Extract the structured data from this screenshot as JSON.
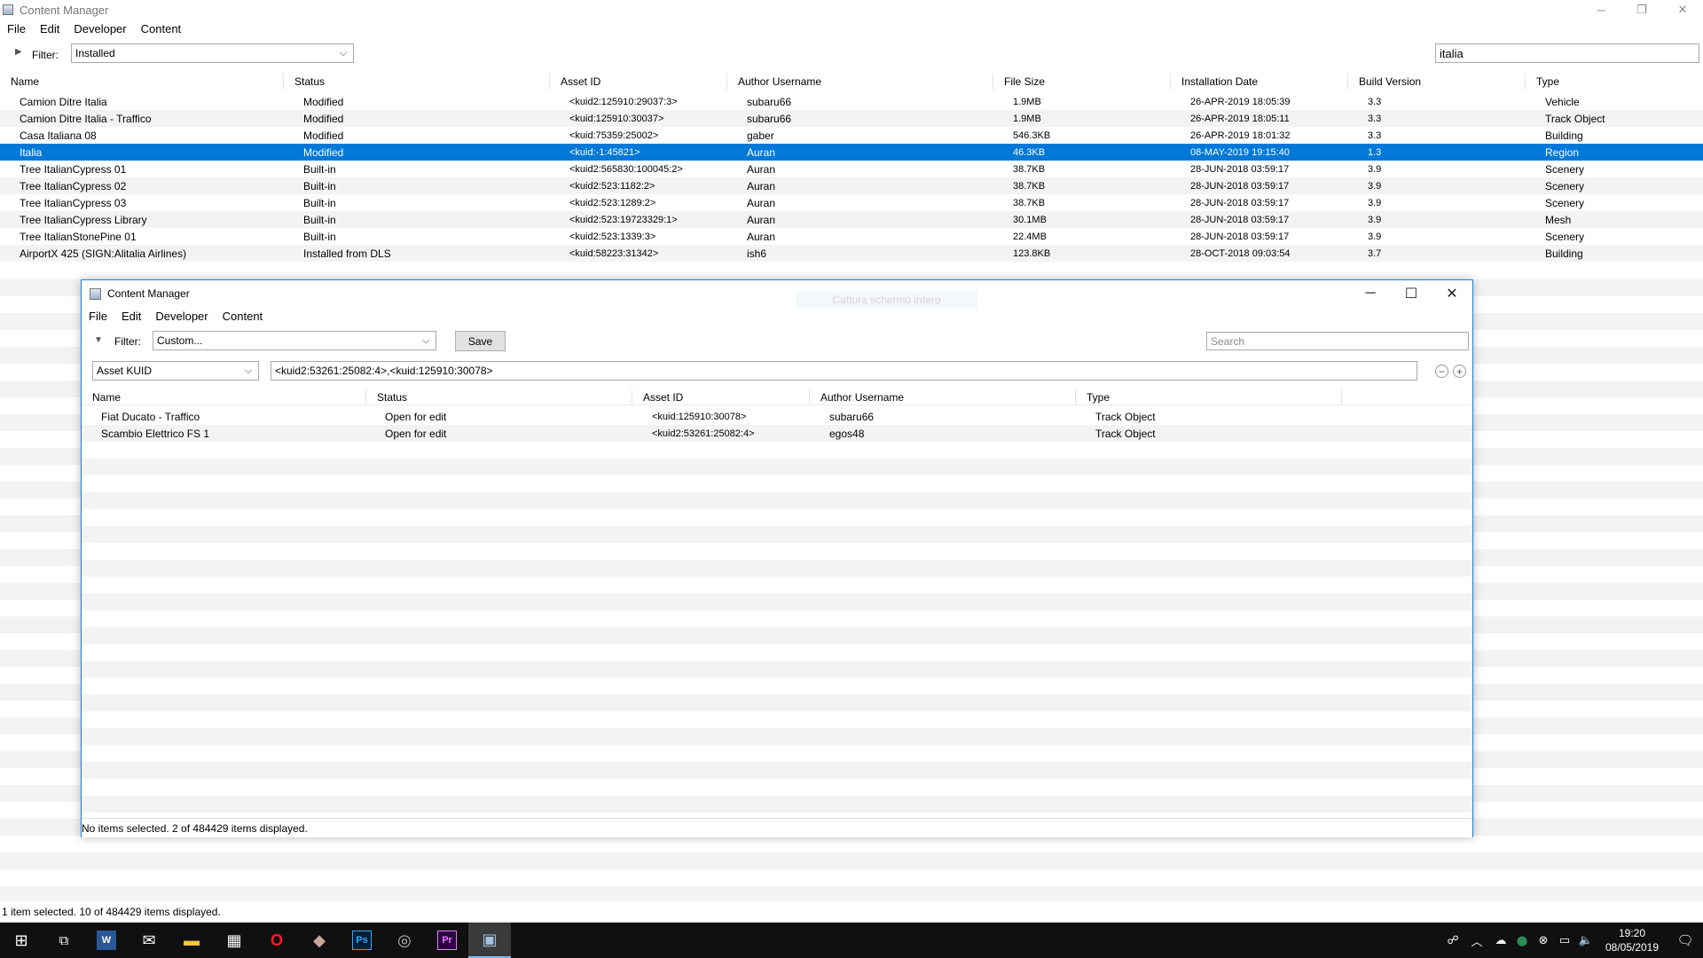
{
  "main": {
    "title": "Content Manager",
    "window_controls": {
      "minimize": "─",
      "restore": "❐",
      "close": "✕"
    },
    "menu": [
      "File",
      "Edit",
      "Developer",
      "Content"
    ],
    "filter": {
      "expander": "▶",
      "label": "Filter:",
      "value": "Installed",
      "chevron": "⌵"
    },
    "search_value": "italia",
    "columns": [
      "Name",
      "Status",
      "Asset ID",
      "Author Username",
      "File Size",
      "Installation Date",
      "Build Version",
      "Type"
    ],
    "rows": [
      {
        "name": "Camion Ditre Italia",
        "status": "Modified",
        "asset_id": "<kuid2:125910:29037:3>",
        "author": "subaru66",
        "size": "1.9MB",
        "date": "26-APR-2019 18:05:39",
        "build": "3.3",
        "type": "Vehicle"
      },
      {
        "name": "Camion Ditre Italia  - Traffico",
        "status": "Modified",
        "asset_id": "<kuid:125910:30037>",
        "author": "subaru66",
        "size": "1.9MB",
        "date": "26-APR-2019 18:05:11",
        "build": "3.3",
        "type": "Track Object"
      },
      {
        "name": "Casa Italiana 08",
        "status": "Modified",
        "asset_id": "<kuid:75359:25002>",
        "author": "gaber",
        "size": "546.3KB",
        "date": "26-APR-2019 18:01:32",
        "build": "3.3",
        "type": "Building"
      },
      {
        "name": "Italia",
        "status": "Modified",
        "asset_id": "<kuid:-1:45821>",
        "author": "Auran",
        "size": "46.3KB",
        "date": "08-MAY-2019 19:15:40",
        "build": "1.3",
        "type": "Region"
      },
      {
        "name": "Tree ItalianCypress 01",
        "status": "Built-in",
        "asset_id": "<kuid2:565830:100045:2>",
        "author": "Auran",
        "size": "38.7KB",
        "date": "28-JUN-2018 03:59:17",
        "build": "3.9",
        "type": "Scenery"
      },
      {
        "name": "Tree ItalianCypress 02",
        "status": "Built-in",
        "asset_id": "<kuid2:523:1182:2>",
        "author": "Auran",
        "size": "38.7KB",
        "date": "28-JUN-2018 03:59:17",
        "build": "3.9",
        "type": "Scenery"
      },
      {
        "name": "Tree ItalianCypress 03",
        "status": "Built-in",
        "asset_id": "<kuid2:523:1289:2>",
        "author": "Auran",
        "size": "38.7KB",
        "date": "28-JUN-2018 03:59:17",
        "build": "3.9",
        "type": "Scenery"
      },
      {
        "name": "Tree ItalianCypress Library",
        "status": "Built-in",
        "asset_id": "<kuid2:523:19723329:1>",
        "author": "Auran",
        "size": "30.1MB",
        "date": "28-JUN-2018 03:59:17",
        "build": "3.9",
        "type": "Mesh"
      },
      {
        "name": "Tree ItalianStonePine 01",
        "status": "Built-in",
        "asset_id": "<kuid2:523:1339:3>",
        "author": "Auran",
        "size": "22.4MB",
        "date": "28-JUN-2018 03:59:17",
        "build": "3.9",
        "type": "Scenery"
      },
      {
        "name": "AirportX 425 (SIGN:Alitalia Airlines)",
        "status": "Installed from DLS",
        "asset_id": "<kuid:58223:31342>",
        "author": "ish6",
        "size": "123.8KB",
        "date": "28-OCT-2018 09:03:54",
        "build": "3.7",
        "type": "Building"
      }
    ],
    "status": "1 item selected. 10 of 484429 items displayed."
  },
  "dialog": {
    "title": "Content Manager",
    "ghost_text": "Cattura schermo intero",
    "window_controls": {
      "minimize": "─",
      "maximize": "☐",
      "close": "✕"
    },
    "menu": [
      "File",
      "Edit",
      "Developer",
      "Content"
    ],
    "filter": {
      "expander": "▼",
      "label": "Filter:",
      "value": "Custom...",
      "chevron": "⌵"
    },
    "save_label": "Save",
    "search_placeholder": "Search",
    "field_combo": "Asset KUID",
    "kuid_query": "<kuid2:53261:25082:4>,<kuid:125910:30078>",
    "remove_btn": "−",
    "add_btn": "+",
    "columns": [
      "Name",
      "Status",
      "Asset ID",
      "Author Username",
      "Type"
    ],
    "rows": [
      {
        "name": "Fiat Ducato  - Traffico",
        "status": "Open for edit",
        "asset_id": "<kuid:125910:30078>",
        "author": "subaru66",
        "type": "Track Object"
      },
      {
        "name": "Scambio Elettrico FS 1",
        "status": "Open for edit",
        "asset_id": "<kuid2:53261:25082:4>",
        "author": "egos48",
        "type": "Track Object"
      }
    ],
    "status": "No items selected. 2 of 484429 items displayed."
  },
  "taskbar": {
    "start": "⊞",
    "task_view": "⧉",
    "apps": [
      {
        "name": "word-icon",
        "glyph": "W",
        "color": "#2b5797"
      },
      {
        "name": "mail-icon",
        "glyph": "✉",
        "color": "#ffffff"
      },
      {
        "name": "explorer-icon",
        "glyph": "▬",
        "color": "#f4c542"
      },
      {
        "name": "calculator-icon",
        "glyph": "▦",
        "color": "#ffffff"
      },
      {
        "name": "opera-icon",
        "glyph": "O",
        "color": "#ff1b2d"
      },
      {
        "name": "fish-app-icon",
        "glyph": "◆",
        "color": "#c9a59a"
      },
      {
        "name": "photoshop-icon",
        "glyph": "Ps",
        "color": "#31a8ff"
      },
      {
        "name": "app-circle-icon",
        "glyph": "◎",
        "color": "#bbbbbb"
      },
      {
        "name": "premiere-icon",
        "glyph": "Pr",
        "color": "#e77cff"
      },
      {
        "name": "trainz-icon",
        "glyph": "▣",
        "color": "#9fc3e0"
      }
    ],
    "tray": [
      "☍",
      "︿",
      "☁",
      "⬤",
      "⊗",
      "▭",
      "🔈"
    ],
    "time": "19:20",
    "date": "08/05/2019",
    "notification": "🗨"
  }
}
